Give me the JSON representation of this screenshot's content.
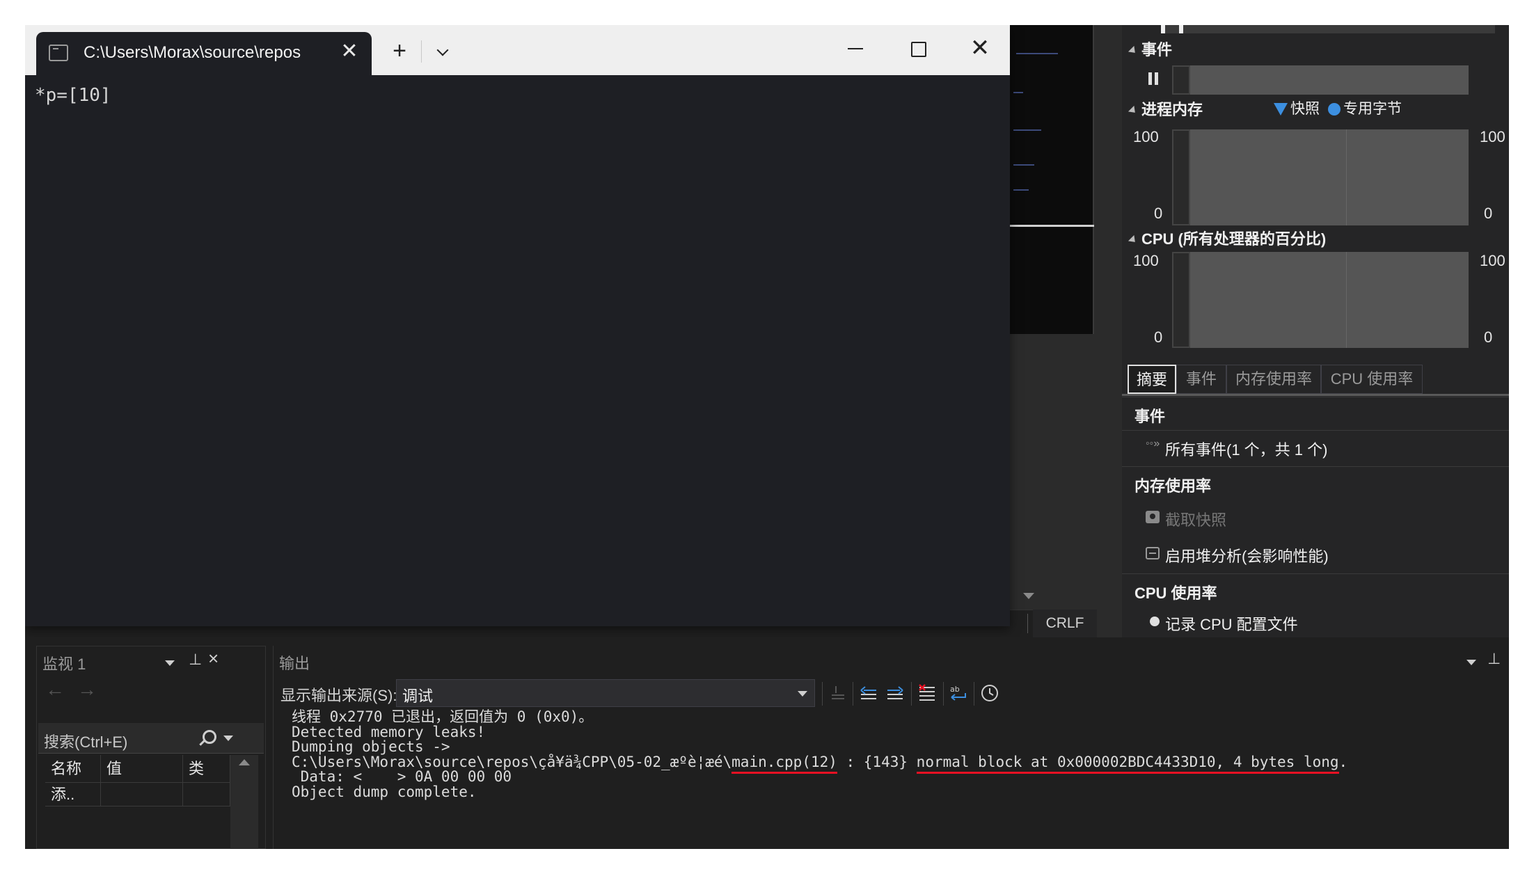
{
  "terminal": {
    "tab_title": "C:\\Users\\Morax\\source\\repos",
    "tab_close": "✕",
    "new_tab": "+",
    "close_window": "✕",
    "output_line": "*p=[10]"
  },
  "diagnostics": {
    "events_header": "事件",
    "process_memory_header": "进程内存",
    "legend_snapshot": "快照",
    "legend_private_bytes": "专用字节",
    "cpu_header": "CPU (所有处理器的百分比)",
    "axis_max": "100",
    "axis_min": "0",
    "tabs": [
      "摘要",
      "事件",
      "内存使用率",
      "CPU 使用率"
    ],
    "summary": {
      "events_title": "事件",
      "all_events": "所有事件(1 个，共 1 个)",
      "memory_title": "内存使用率",
      "take_snapshot": "截取快照",
      "enable_heap": "启用堆分析(会影响性能)",
      "cpu_title": "CPU 使用率",
      "record_cpu": "记录 CPU 配置文件"
    }
  },
  "status_bar": {
    "line_ending": "CRLF"
  },
  "watch": {
    "title": "监视 1",
    "search_placeholder": "搜索(Ctrl+E)",
    "columns": [
      "名称",
      "值",
      "类"
    ],
    "add_row": "添.."
  },
  "output": {
    "title": "输出",
    "source_label": "显示输出来源(S):",
    "source_value": "调试",
    "lines": {
      "l1": "线程 0x2770 已退出，返回值为 0 (0x0)。",
      "l2": "Detected memory leaks!",
      "l3": "Dumping objects ->",
      "l4_prefix": "C:\\Users\\Morax\\source\\repos\\çå¥ä¾CPP\\05-02_æº­è¦æé\\",
      "l4_file": "main.cpp(12)",
      "l4_mid": " : {143} ",
      "l4_block": "normal block at 0x000002BDC4433D10, 4 bytes long",
      "l4_end": ".",
      "l5": " Data: <    > 0A 00 00 00",
      "l6": "Object dump complete."
    }
  }
}
